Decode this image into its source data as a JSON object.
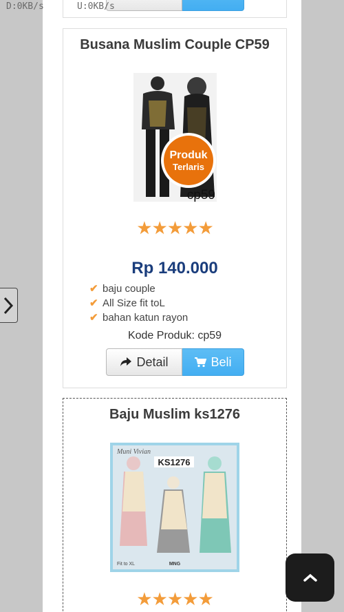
{
  "status_bar": {
    "down": "D:0KB/s",
    "up": "U:0KB/s"
  },
  "products": [
    {
      "title": "Busana Muslim Couple CP59",
      "badge_line1": "Produk",
      "badge_line2": "Terlaris",
      "image_code": "cp59",
      "rating": "★★★★★",
      "price": "Rp 140.000",
      "features": [
        "baju couple",
        "All Size fit toL",
        "bahan katun rayon"
      ],
      "code": "Kode Produk: cp59",
      "detail_label": "Detail",
      "buy_label": "Beli"
    },
    {
      "title": "Baju Muslim ks1276",
      "image_code": "KS1276",
      "image_brand": "Muni Vivian",
      "image_size": "Fit to XL",
      "image_logo": "MNG",
      "rating": "★★★★★"
    }
  ],
  "colors": {
    "price": "#1a3d7c",
    "star": "#f39c3a",
    "buy": "#43aef2",
    "badge": "#e8720c"
  },
  "icons": {
    "side": "chevron-right-icon",
    "top": "chevron-up-icon",
    "detail": "share-arrow-icon",
    "buy": "cart-icon",
    "check": "check-icon"
  }
}
